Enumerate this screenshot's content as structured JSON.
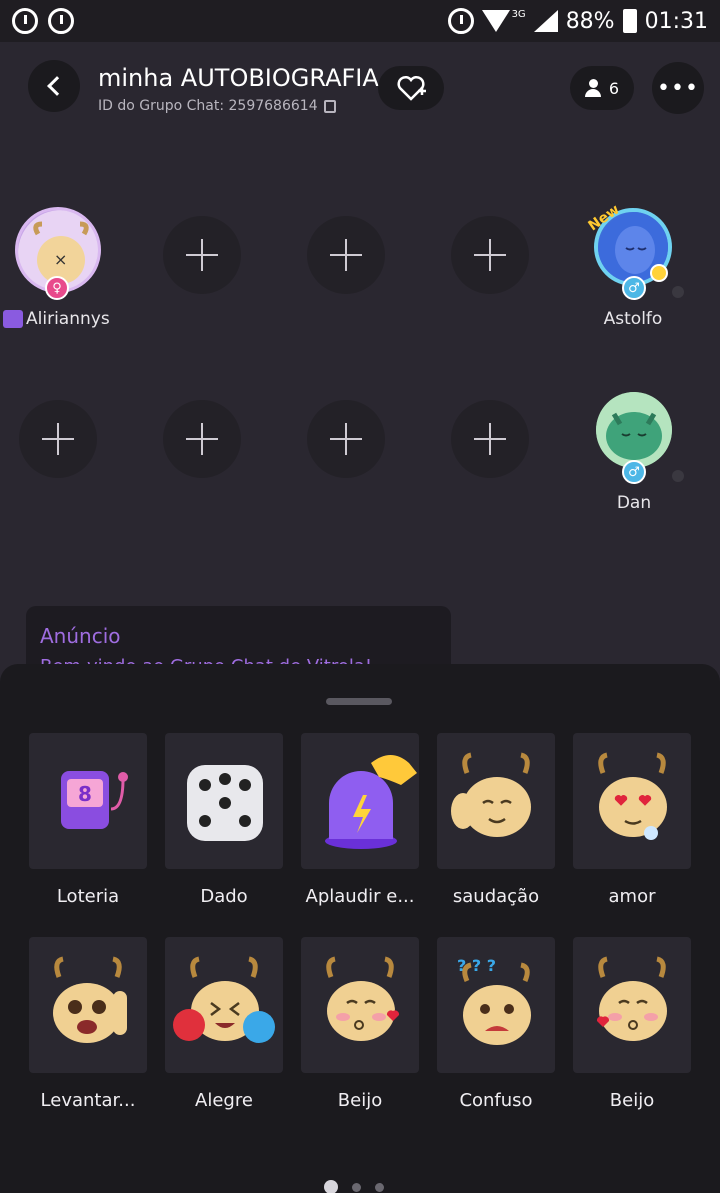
{
  "status_bar": {
    "battery": "88%",
    "time": "01:31",
    "network": "3G"
  },
  "header": {
    "title": "minha AUTOBIOGRAFIA",
    "subtitle": "ID do Grupo Chat: 2597686614",
    "member_count": "6"
  },
  "seats": {
    "row1": [
      {
        "type": "user",
        "name": "Aliriannys"
      },
      {
        "type": "empty"
      },
      {
        "type": "empty"
      },
      {
        "type": "empty"
      },
      {
        "type": "user",
        "name": "Astolfo",
        "badge": "New"
      }
    ],
    "row2": [
      {
        "type": "empty"
      },
      {
        "type": "empty"
      },
      {
        "type": "empty"
      },
      {
        "type": "empty"
      },
      {
        "type": "user",
        "name": "Dan"
      }
    ]
  },
  "announcement": {
    "title": "Anúncio",
    "body": "Bem-vindo ao Grupo Chat de Vitrola!"
  },
  "stickers": [
    {
      "label": "Loteria",
      "icon": "slot-machine-icon"
    },
    {
      "label": "Dado",
      "icon": "dice-icon"
    },
    {
      "label": "Aplaudir e...",
      "icon": "clap-button-icon"
    },
    {
      "label": "saudação",
      "icon": "deer-wave-icon"
    },
    {
      "label": "amor",
      "icon": "deer-love-icon"
    },
    {
      "label": "Levantar...",
      "icon": "deer-raise-hand-icon"
    },
    {
      "label": "Alegre",
      "icon": "deer-cheer-icon"
    },
    {
      "label": "Beijo",
      "icon": "deer-kiss-icon"
    },
    {
      "label": "Confuso",
      "icon": "deer-confused-icon"
    },
    {
      "label": "Beijo",
      "icon": "deer-kiss-icon"
    }
  ],
  "colors": {
    "accent": "#9f6de0",
    "male_badge": "#4db7e6",
    "background": "#2a2730",
    "sheet": "#1b1a1e"
  },
  "pager": {
    "pages": 3,
    "current": 1
  }
}
